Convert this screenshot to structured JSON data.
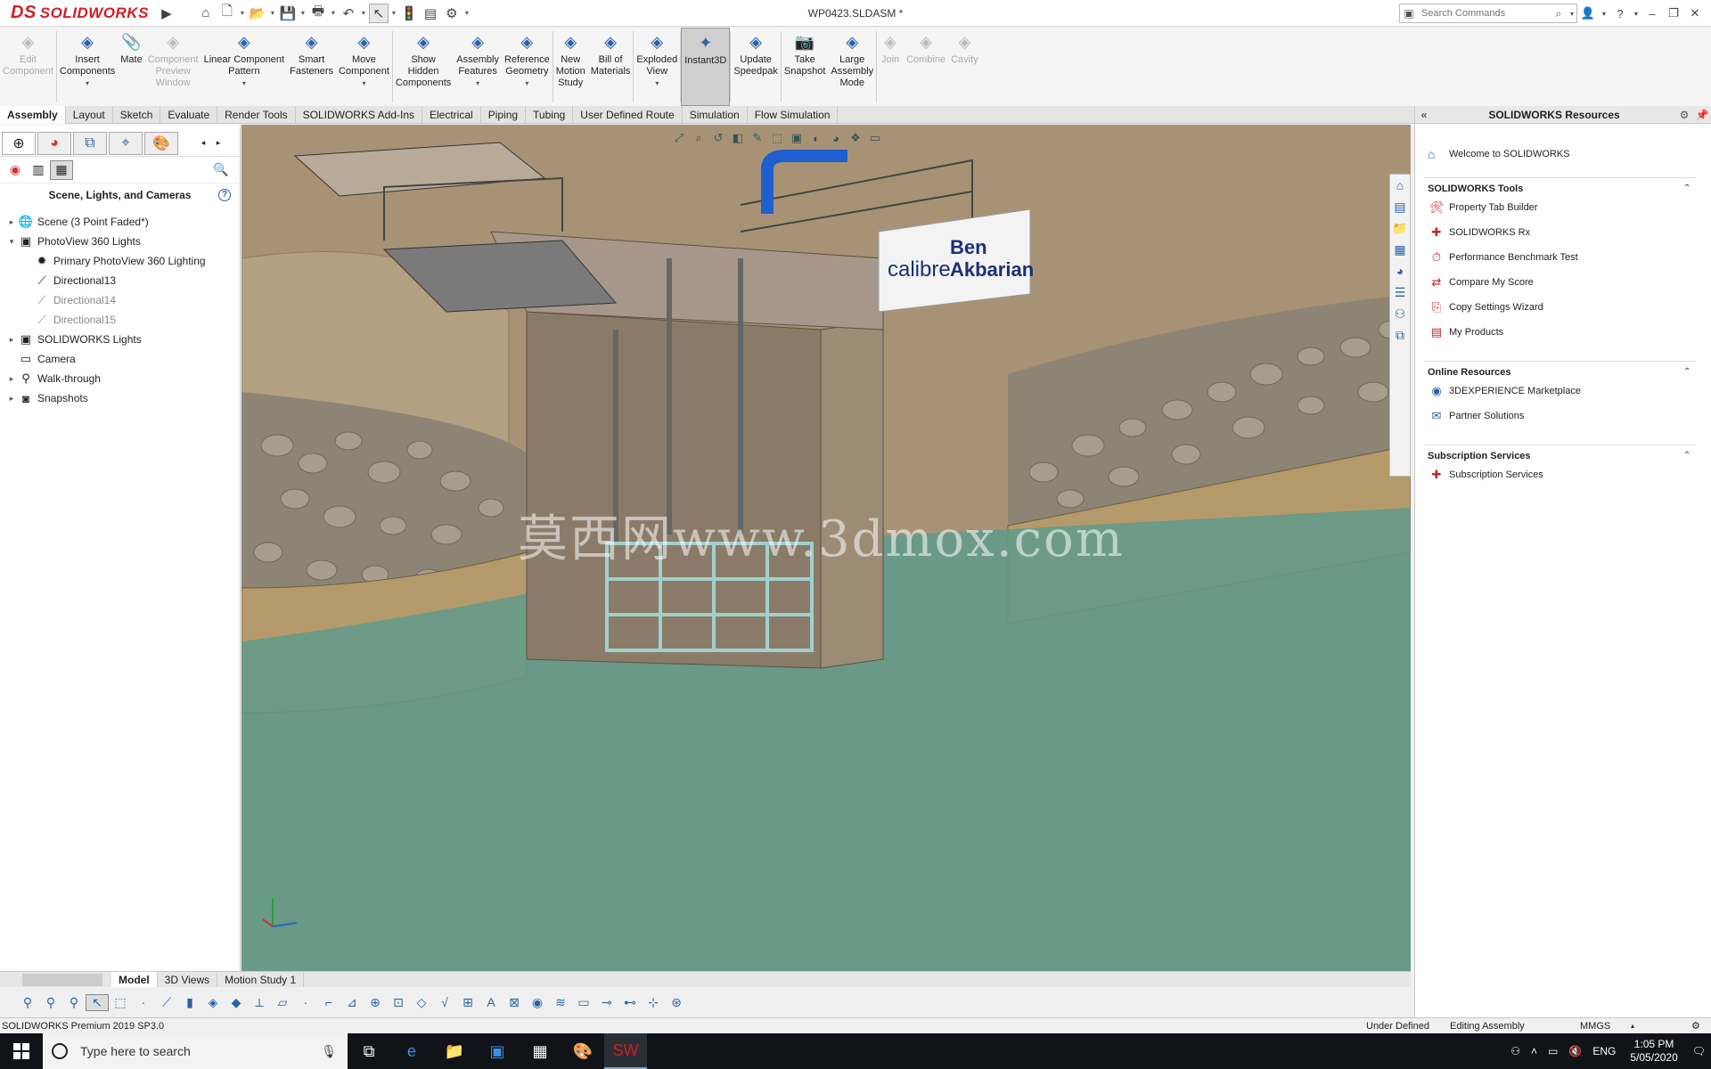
{
  "app": {
    "logo": "SOLIDWORKS",
    "logo_mark": "DS",
    "document_title": "WP0423.SLDASM *",
    "search_placeholder": "Search Commands"
  },
  "quick_access": [
    "home-icon",
    "new-icon",
    "open-icon",
    "save-icon",
    "print-icon",
    "undo-icon",
    "select-icon",
    "rebuild-icon",
    "file-props-icon",
    "options-icon"
  ],
  "command_manager": [
    {
      "label": "Edit\nComponent",
      "icon": "edit-component-icon",
      "disabled": true
    },
    {
      "label": "Insert\nComponents",
      "icon": "insert-components-icon",
      "disabled": false,
      "dropdown": true
    },
    {
      "label": "Mate",
      "icon": "mate-icon",
      "disabled": false
    },
    {
      "label": "Component\nPreview\nWindow",
      "icon": "component-preview-icon",
      "disabled": true
    },
    {
      "label": "Linear Component\nPattern",
      "icon": "linear-pattern-icon",
      "disabled": false,
      "dropdown": true
    },
    {
      "label": "Smart\nFasteners",
      "icon": "smart-fasteners-icon",
      "disabled": false
    },
    {
      "label": "Move\nComponent",
      "icon": "move-component-icon",
      "disabled": false,
      "dropdown": true
    },
    {
      "label": "Show\nHidden\nComponents",
      "icon": "show-hidden-icon",
      "disabled": false
    },
    {
      "label": "Assembly\nFeatures",
      "icon": "assembly-features-icon",
      "disabled": false,
      "dropdown": true
    },
    {
      "label": "Reference\nGeometry",
      "icon": "reference-geometry-icon",
      "disabled": false,
      "dropdown": true
    },
    {
      "label": "New\nMotion\nStudy",
      "icon": "motion-study-icon",
      "disabled": false
    },
    {
      "label": "Bill of\nMaterials",
      "icon": "bill-of-materials-icon",
      "disabled": false
    },
    {
      "label": "Exploded\nView",
      "icon": "exploded-view-icon",
      "disabled": false,
      "dropdown": true
    },
    {
      "label": "Instant3D",
      "icon": "instant3d-icon",
      "disabled": false,
      "active": true
    },
    {
      "label": "Update\nSpeedpak",
      "icon": "speedpak-icon",
      "disabled": false
    },
    {
      "label": "Take\nSnapshot",
      "icon": "snapshot-icon",
      "disabled": false
    },
    {
      "label": "Large\nAssembly\nMode",
      "icon": "large-assembly-icon",
      "disabled": false
    },
    {
      "label": "Join",
      "icon": "join-icon",
      "disabled": true
    },
    {
      "label": "Combine",
      "icon": "combine-icon",
      "disabled": true
    },
    {
      "label": "Cavity",
      "icon": "cavity-icon",
      "disabled": true
    }
  ],
  "tabs": [
    "Assembly",
    "Layout",
    "Sketch",
    "Evaluate",
    "Render Tools",
    "SOLIDWORKS Add-Ins",
    "Electrical",
    "Piping",
    "Tubing",
    "User Defined Route",
    "Simulation",
    "Flow Simulation"
  ],
  "left_panel": {
    "title": "Scene, Lights, and Cameras",
    "tree": [
      {
        "label": "Scene (3 Point Faded*)",
        "level": 0,
        "expander": "▸",
        "icon": "scene-icon",
        "dim": false
      },
      {
        "label": "PhotoView 360 Lights",
        "level": 0,
        "expander": "▾",
        "icon": "photoview-lights-icon",
        "dim": false
      },
      {
        "label": "Primary PhotoView 360 Lighting",
        "level": 1,
        "expander": "",
        "icon": "primary-lighting-icon",
        "dim": false
      },
      {
        "label": "Directional13",
        "level": 1,
        "expander": "",
        "icon": "directional-light-icon",
        "dim": false
      },
      {
        "label": "Directional14",
        "level": 1,
        "expander": "",
        "icon": "directional-light-icon",
        "dim": true
      },
      {
        "label": "Directional15",
        "level": 1,
        "expander": "",
        "icon": "directional-light-icon",
        "dim": true
      },
      {
        "label": "SOLIDWORKS Lights",
        "level": 0,
        "expander": "▸",
        "icon": "solidworks-lights-icon",
        "dim": false
      },
      {
        "label": "Camera",
        "level": 0,
        "expander": "",
        "icon": "camera-icon",
        "dim": false
      },
      {
        "label": "Walk-through",
        "level": 0,
        "expander": "▸",
        "icon": "walkthrough-icon",
        "dim": false
      },
      {
        "label": "Snapshots",
        "level": 0,
        "expander": "▸",
        "icon": "snapshots-icon",
        "dim": false
      }
    ]
  },
  "viewport": {
    "watermark": "莫西网www.3dmox.com",
    "sign_line1": "Ben",
    "sign_line2": "Akbarian",
    "sign_logo": "calibre"
  },
  "bottom_tabs": [
    "Model",
    "3D Views",
    "Motion Study 1"
  ],
  "status": {
    "product": "SOLIDWORKS Premium 2019 SP3.0",
    "definition": "Under Defined",
    "mode": "Editing Assembly",
    "units": "MMGS"
  },
  "resources": {
    "title": "SOLIDWORKS Resources",
    "welcome": "Welcome to SOLIDWORKS",
    "sections": [
      {
        "title": "SOLIDWORKS Tools",
        "items": [
          "Property Tab Builder",
          "SOLIDWORKS Rx",
          "Performance Benchmark Test",
          "Compare My Score",
          "Copy Settings Wizard",
          "My Products"
        ]
      },
      {
        "title": "Online Resources",
        "items": [
          "3DEXPERIENCE Marketplace",
          "Partner Solutions"
        ]
      },
      {
        "title": "Subscription Services",
        "items": [
          "Subscription Services"
        ]
      }
    ]
  },
  "taskbar": {
    "search_placeholder": "Type here to search",
    "lang": "ENG",
    "time": "1:05 PM",
    "date": "5/05/2020"
  }
}
